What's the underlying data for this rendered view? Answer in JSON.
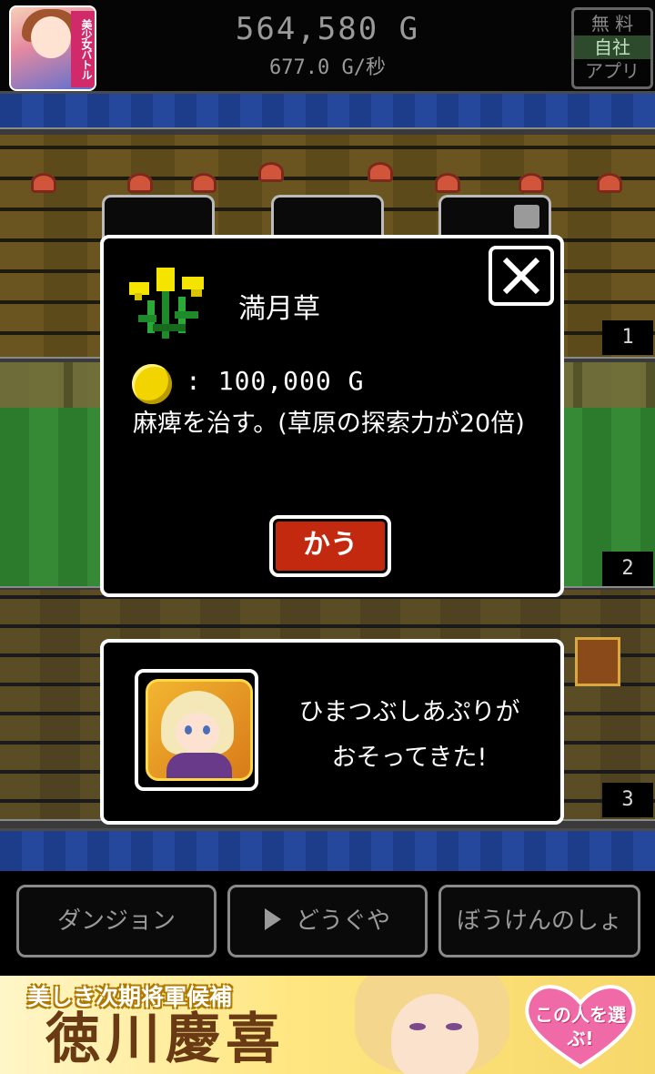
{
  "header": {
    "app_icon_label": "美少女バトル",
    "gold": "564,580 G",
    "gold_rate": "677.0 G/秒",
    "free_app": {
      "line1": "無 料",
      "line2": "自社",
      "line3": "アプリ"
    }
  },
  "floors": [
    {
      "number": "1"
    },
    {
      "number": "2"
    },
    {
      "number": "3"
    }
  ],
  "item_dialog": {
    "name": "満月草",
    "price_sep": ":",
    "price": "100,000 G",
    "description": "麻痺を治す。(草原の探索力が20倍)",
    "buy_label": "かう",
    "icon": "yellow-herb-icon",
    "close_icon": "close-icon"
  },
  "encounter": {
    "line1": "ひまつぶしあぷりが",
    "line2": "おそってきた!"
  },
  "nav": {
    "dungeon": "ダンジョン",
    "items": "どうぐや",
    "journal": "ぼうけんのしょ"
  },
  "ad": {
    "subtitle": "美しき次期将軍候補",
    "title": "徳川慶喜",
    "cta": "この人を選ぶ!"
  },
  "colors": {
    "buy_button": "#c2290f",
    "coin": "#f2d400",
    "water": "#1d3c8a"
  }
}
